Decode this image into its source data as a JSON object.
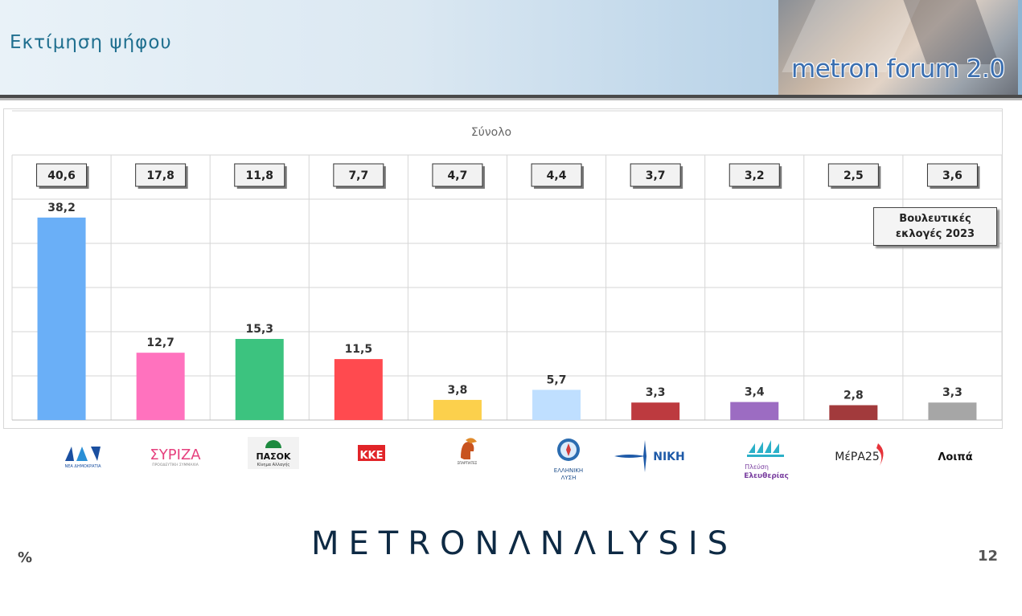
{
  "header": {
    "title": "Εκτίμηση ψήφου",
    "logo_text": "metron forum 2.0"
  },
  "chart_data": {
    "type": "bar",
    "title": "Σύνολο",
    "categories": [
      "ΝΔ",
      "ΣΥΡΙΖΑ",
      "ΠΑΣΟΚ",
      "ΚΚΕ",
      "ΣΠΑΡΤΙΑΤΕΣ",
      "ΕΛΛΗΝΙΚΗ ΛΥΣΗ",
      "ΝΙΚΗ",
      "Πλεύση Ελευθερίας",
      "ΜέΡΑ25",
      "Λοιπά"
    ],
    "series": [
      {
        "name": "",
        "values": [
          38.2,
          12.7,
          15.3,
          11.5,
          3.8,
          5.7,
          3.3,
          3.4,
          2.8,
          3.3
        ]
      },
      {
        "name": "Βουλευτικές εκλογές 2023",
        "values": [
          40.6,
          17.8,
          11.8,
          7.7,
          4.7,
          4.4,
          3.7,
          3.2,
          2.5,
          3.6
        ]
      }
    ],
    "value_labels": [
      "38,2",
      "12,7",
      "15,3",
      "11,5",
      "3,8",
      "5,7",
      "3,3",
      "3,4",
      "2,8",
      "3,3"
    ],
    "election_labels": [
      "40,6",
      "17,8",
      "11,8",
      "7,7",
      "4,7",
      "4,4",
      "3,7",
      "3,2",
      "2,5",
      "3,6"
    ],
    "colors": [
      "#6aaff7",
      "#ff72be",
      "#3cc37f",
      "#ff4a4f",
      "#fcd04c",
      "#bfdfff",
      "#bd3a3f",
      "#9c6cc2",
      "#a23a3c",
      "#a6a6a6"
    ],
    "ylim": [
      0,
      50
    ],
    "grid": true,
    "legend": "top-right"
  },
  "legend": {
    "line1": "Βουλευτικές",
    "line2": "εκλογές 2023"
  },
  "logos": {
    "nd": "ΝΔ",
    "nd_sub": "ΝΕΑ ΔΗΜΟΚΡΑΤΙΑ",
    "syriza": "ΣΥΡΙΖΑ",
    "syriza_sub": "ΠΡΟΟΔΕΥΤΙΚΗ ΣΥΜΜΑΧΙΑ",
    "pasok": "ΠΑΣΟΚ",
    "pasok_sub": "Κίνημα Αλλαγής",
    "kke": "ΚΚΕ",
    "spartiates_sub": "ΣΠΑΡΤΙΑΤΕΣ",
    "el_line1": "ΕΛΛΗΝΙΚΗ",
    "el_line2": "ΛΥΣΗ",
    "niki": "ΝΙΚΗ",
    "plefsi_line1": "Πλεύση",
    "plefsi_line2": "Ελευθερίας",
    "mera": "ΜέΡΑ25",
    "others": "Λοιπά"
  },
  "footer": {
    "brand": "METRONΛNΛLYSIS",
    "percent": "%",
    "page": "12"
  }
}
